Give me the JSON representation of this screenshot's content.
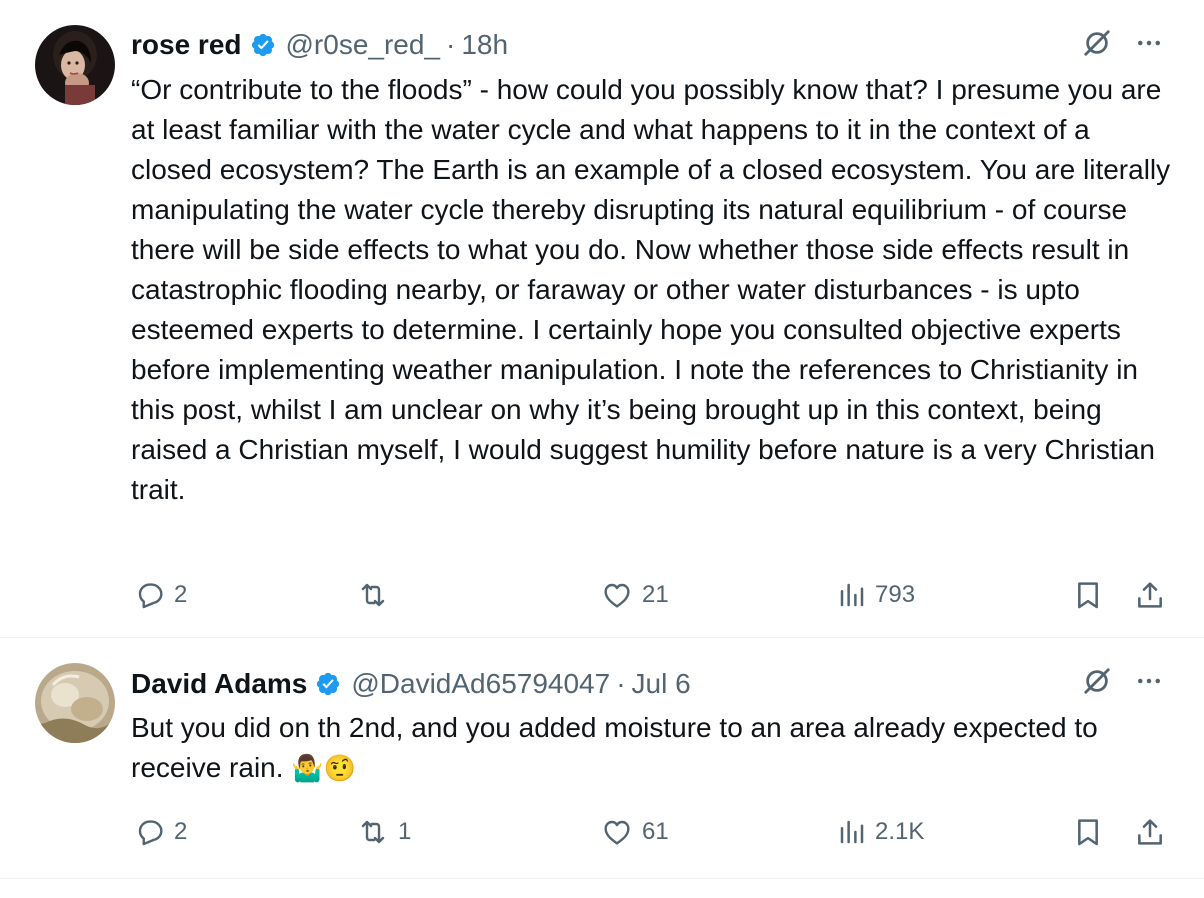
{
  "tweets": [
    {
      "author": {
        "name": "rose red",
        "handle": "@r0se_red_",
        "verified": true,
        "avatar_icon": "avatar-photo"
      },
      "separator": "·",
      "time": "18h",
      "text": "“Or contribute to the floods” - how could you possibly know that? I presume you are at least familiar with the water cycle and what happens to it in the context of a closed ecosystem? The Earth is an example of a closed ecosystem. You are literally manipulating the water cycle thereby disrupting its natural equilibrium - of course there will be side effects to what you do. Now whether those side effects result in catastrophic flooding nearby, or faraway or other water disturbances - is upto esteemed experts to determine. I certainly hope you consulted objective experts before implementing weather manipulation. I note the references to Christianity in this post, whilst I am unclear on why it’s being brought up in this context, being raised a Christian myself, I would suggest humility before nature is a very Christian trait.",
      "stats": {
        "replies": "2",
        "reposts": "",
        "likes": "21",
        "views": "793"
      }
    },
    {
      "author": {
        "name": "David Adams",
        "handle": "@DavidAd65794047",
        "verified": true,
        "avatar_icon": "avatar-photo"
      },
      "separator": "·",
      "time": "Jul 6",
      "text": "But you did on th 2nd, and you added moisture to an area already expected to receive rain.",
      "emojis": "🤷‍♂️🤨",
      "stats": {
        "replies": "2",
        "reposts": "1",
        "likes": "61",
        "views": "2.1K"
      }
    }
  ],
  "colors": {
    "text": "#0f1419",
    "secondary": "#536471",
    "verified": "#1d9bf0",
    "divider": "#eff3f4"
  },
  "icons": {
    "reply": "reply-icon",
    "repost": "repost-icon",
    "like": "like-icon",
    "views": "views-icon",
    "bookmark": "bookmark-icon",
    "share": "share-icon",
    "grok": "grok-icon",
    "more": "more-icon"
  }
}
